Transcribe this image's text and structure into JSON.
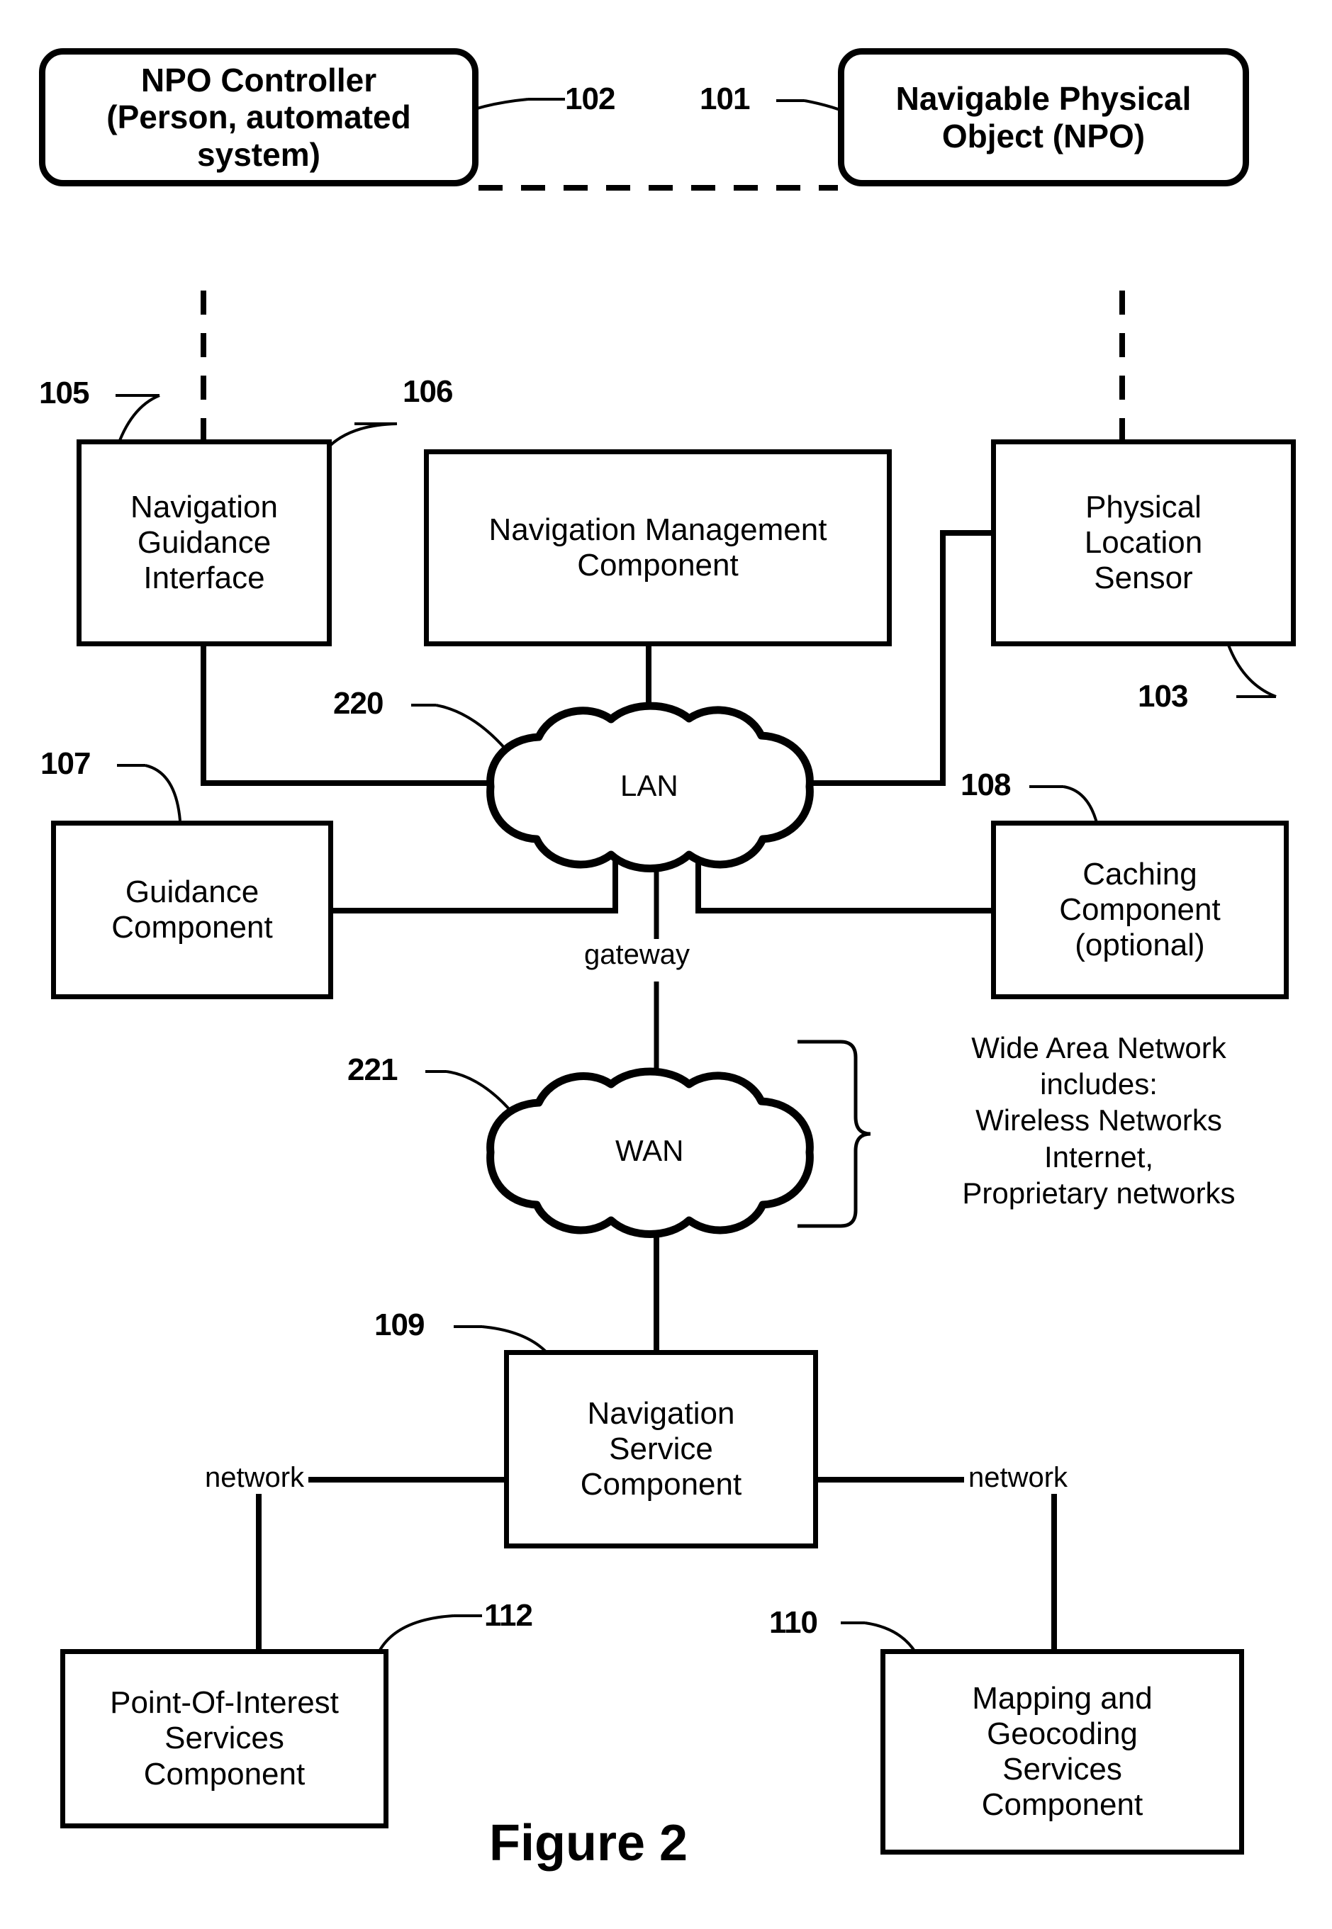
{
  "figure": {
    "caption": "Figure 2",
    "type": "patent-system-block-diagram"
  },
  "nodes": [
    {
      "id": "102",
      "ref": "102",
      "name": "npo-controller",
      "lines": [
        "NPO Controller",
        "(Person, automated",
        "system)"
      ],
      "shape": "rounded",
      "bold": true
    },
    {
      "id": "101",
      "ref": "101",
      "name": "navigable-physical-object",
      "lines": [
        "Navigable Physical",
        "Object (NPO)"
      ],
      "shape": "rounded",
      "bold": true
    },
    {
      "id": "105",
      "ref": "105",
      "name": "navigation-guidance-interface",
      "lines": [
        "Navigation",
        "Guidance",
        "Interface"
      ],
      "shape": "rect",
      "bold": false
    },
    {
      "id": "106",
      "ref": "106",
      "name": "navigation-management-component",
      "lines": [
        "Navigation Management",
        "Component"
      ],
      "shape": "rect",
      "bold": false
    },
    {
      "id": "103",
      "ref": "103",
      "name": "physical-location-sensor",
      "lines": [
        "Physical",
        "Location",
        "Sensor"
      ],
      "shape": "rect",
      "bold": false
    },
    {
      "id": "107",
      "ref": "107",
      "name": "guidance-component",
      "lines": [
        "Guidance",
        "Component"
      ],
      "shape": "rect",
      "bold": false
    },
    {
      "id": "108",
      "ref": "108",
      "name": "caching-component",
      "lines": [
        "Caching",
        "Component",
        "(optional)"
      ],
      "shape": "rect",
      "bold": false
    },
    {
      "id": "109",
      "ref": "109",
      "name": "navigation-service-component",
      "lines": [
        "Navigation",
        "Service",
        "Component"
      ],
      "shape": "rect",
      "bold": false
    },
    {
      "id": "112",
      "ref": "112",
      "name": "point-of-interest-services-component",
      "lines": [
        "Point-Of-Interest",
        "Services",
        "Component"
      ],
      "shape": "rect",
      "bold": false
    },
    {
      "id": "110",
      "ref": "110",
      "name": "mapping-and-geocoding-services-component",
      "lines": [
        "Mapping and",
        "Geocoding",
        "Services",
        "Component"
      ],
      "shape": "rect",
      "bold": false
    }
  ],
  "clouds": [
    {
      "id": "220",
      "ref": "220",
      "name": "lan-cloud",
      "label": "LAN"
    },
    {
      "id": "221",
      "ref": "221",
      "name": "wan-cloud",
      "label": "WAN"
    }
  ],
  "labels": {
    "gateway": "gateway",
    "network_left": "network",
    "network_right": "network"
  },
  "wan_note": {
    "lines": [
      "Wide Area Network",
      "includes:",
      "Wireless Networks",
      "Internet,",
      "Proprietary networks"
    ]
  },
  "refs": {
    "r101": "101",
    "r102": "102",
    "r103": "103",
    "r105": "105",
    "r106": "106",
    "r107": "107",
    "r108": "108",
    "r109": "109",
    "r110": "110",
    "r112": "112",
    "r220": "220",
    "r221": "221"
  },
  "node_text": {
    "npo_controller_l1": "NPO Controller",
    "npo_controller_l2": "(Person, automated",
    "npo_controller_l3": "system)",
    "npo_l1": "Navigable Physical",
    "npo_l2": "Object (NPO)",
    "ngi_l1": "Navigation",
    "ngi_l2": "Guidance",
    "ngi_l3": "Interface",
    "nmc_l1": "Navigation Management",
    "nmc_l2": "Component",
    "pls_l1": "Physical",
    "pls_l2": "Location",
    "pls_l3": "Sensor",
    "gc_l1": "Guidance",
    "gc_l2": "Component",
    "cc_l1": "Caching",
    "cc_l2": "Component",
    "cc_l3": "(optional)",
    "nsc_l1": "Navigation",
    "nsc_l2": "Service",
    "nsc_l3": "Component",
    "poi_l1": "Point-Of-Interest",
    "poi_l2": "Services",
    "poi_l3": "Component",
    "mgs_l1": "Mapping and",
    "mgs_l2": "Geocoding",
    "mgs_l3": "Services",
    "mgs_l4": "Component"
  },
  "wan_note_text": {
    "l1": "Wide Area Network",
    "l2": "includes:",
    "l3": "Wireless Networks",
    "l4": "Internet,",
    "l5": "Proprietary networks"
  },
  "colors": {
    "ink": "#000000",
    "paper": "#ffffff"
  }
}
